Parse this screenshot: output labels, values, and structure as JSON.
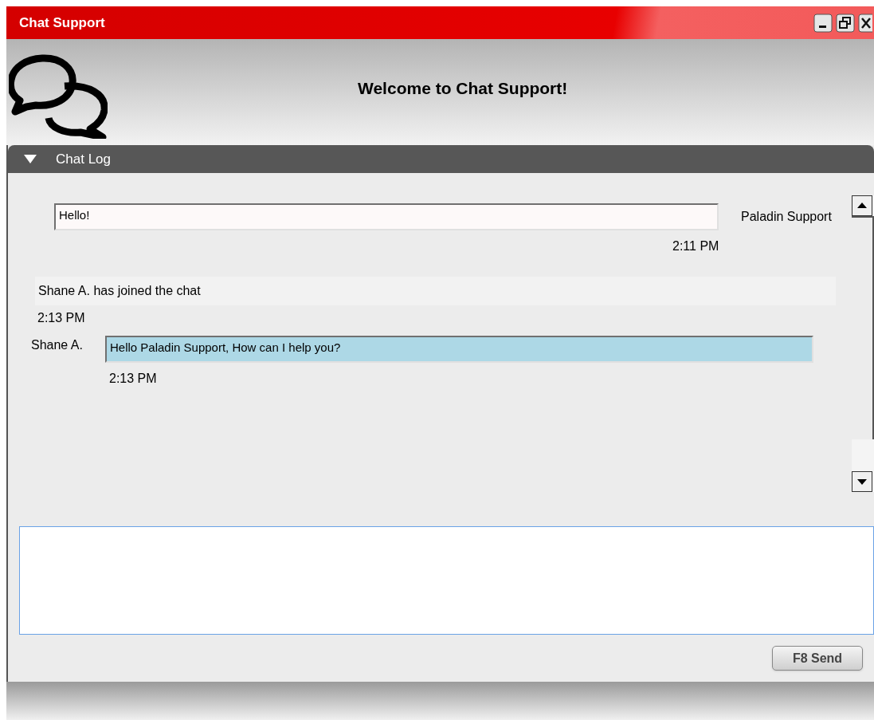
{
  "window": {
    "title": "Chat Support"
  },
  "header": {
    "title": "Welcome to Chat Support!"
  },
  "chat_log": {
    "label": "Chat Log",
    "expanded": true,
    "messages": [
      {
        "kind": "outgoing",
        "text": "Hello!",
        "sender": "Paladin Support",
        "time": "2:11 PM"
      },
      {
        "kind": "system",
        "text": "Shane A. has joined the chat",
        "time": "2:13 PM"
      },
      {
        "kind": "incoming",
        "text": "Hello Paladin Support, How can I help you?",
        "sender": "Shane A.",
        "time": "2:13 PM"
      }
    ]
  },
  "compose": {
    "send_button": "F8 Send"
  }
}
